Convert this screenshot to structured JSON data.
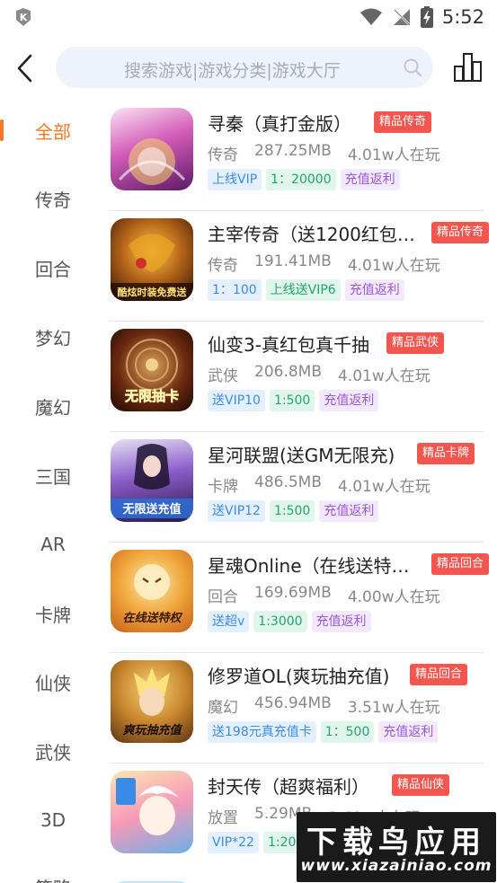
{
  "status_bar": {
    "time": "5:52"
  },
  "search": {
    "placeholder": "搜索游戏|游戏分类|游戏大厅"
  },
  "categories": [
    {
      "label": "全部",
      "active": true
    },
    {
      "label": "传奇"
    },
    {
      "label": "回合"
    },
    {
      "label": "梦幻"
    },
    {
      "label": "魔幻"
    },
    {
      "label": "三国"
    },
    {
      "label": "AR"
    },
    {
      "label": "卡牌"
    },
    {
      "label": "仙侠"
    },
    {
      "label": "武侠"
    },
    {
      "label": "3D"
    },
    {
      "label": "策略"
    }
  ],
  "games": [
    {
      "name": "寻秦（真打金版）",
      "badge": "精品传奇",
      "genre": "传奇",
      "size": "287.25MB",
      "players": "4.01w人在玩",
      "tags": [
        {
          "text": "上线VIP",
          "style": "blue"
        },
        {
          "text": "1：20000",
          "style": "green"
        },
        {
          "text": "充值返利",
          "style": "purple"
        }
      ],
      "icon_colors": [
        "#f4c2e8",
        "#c13aa6",
        "#5b1a66"
      ]
    },
    {
      "name": "主宰传奇（送1200红包…",
      "badge": "精品传奇",
      "genre": "传奇",
      "size": "191.41MB",
      "players": "4.01w人在玩",
      "tags": [
        {
          "text": "1：100",
          "style": "blue"
        },
        {
          "text": "上线送VIP6",
          "style": "green"
        },
        {
          "text": "充值返利",
          "style": "purple"
        }
      ],
      "icon_colors": [
        "#f6c94a",
        "#b8661a",
        "#2b1005"
      ],
      "icon_text": "酷炫时装免费送"
    },
    {
      "name": "仙变3-真红包真千抽",
      "badge": "精品武侠",
      "genre": "武侠",
      "size": "206.8MB",
      "players": "4.01w人在玩",
      "tags": [
        {
          "text": "送VIP10",
          "style": "blue"
        },
        {
          "text": "1:500",
          "style": "green"
        },
        {
          "text": "充值返利",
          "style": "purple"
        }
      ],
      "icon_colors": [
        "#d9a35a",
        "#6b2a10",
        "#1d0804"
      ],
      "icon_text": "无限抽卡"
    },
    {
      "name": "星河联盟(送GM无限充)",
      "badge": "精品卡牌",
      "genre": "卡牌",
      "size": "486.5MB",
      "players": "4.01w人在玩",
      "tags": [
        {
          "text": "送VIP12",
          "style": "blue"
        },
        {
          "text": "1:500",
          "style": "green"
        },
        {
          "text": "充值返利",
          "style": "purple"
        }
      ],
      "icon_colors": [
        "#e6dff4",
        "#6d3aa8",
        "#2a1648"
      ],
      "icon_text": "无限送充值"
    },
    {
      "name": "星魂Online（在线送特…",
      "badge": "精品回合",
      "genre": "回合",
      "size": "169.69MB",
      "players": "4.00w人在玩",
      "tags": [
        {
          "text": "送超v",
          "style": "blue"
        },
        {
          "text": "1:3000",
          "style": "green"
        },
        {
          "text": "充值返利",
          "style": "purple"
        }
      ],
      "icon_colors": [
        "#fce9a8",
        "#f0a53a",
        "#c5601a"
      ],
      "icon_text": "在线送特权"
    },
    {
      "name": "修罗道OL(爽玩抽充值)",
      "badge": "精品回合",
      "genre": "魔幻",
      "size": "456.94MB",
      "players": "3.51w人在玩",
      "tags": [
        {
          "text": "送198元真充值卡",
          "style": "blue"
        },
        {
          "text": "1：500",
          "style": "green"
        },
        {
          "text": "充值返利",
          "style": "purple"
        }
      ],
      "icon_colors": [
        "#f6d27a",
        "#c9862e",
        "#5a3312"
      ],
      "icon_text": "爽玩抽充值"
    },
    {
      "name": "封天传（超爽福利）",
      "badge": "精品仙侠",
      "genre": "放置",
      "size": "5.29MB",
      "players": "3.41w人在玩",
      "tags": [
        {
          "text": "VIP*22",
          "style": "blue"
        },
        {
          "text": "1:200",
          "style": "green"
        }
      ],
      "icon_colors": [
        "#ffe6b0",
        "#f59ab8",
        "#6ab0e8"
      ]
    }
  ],
  "watermark": {
    "title": "下载鸟应用",
    "subtitle": "www.xiazainiao.com"
  },
  "colors": {
    "accent": "#f07a2a",
    "badge": "#f2564e",
    "search_bg": "#eef3fb"
  }
}
